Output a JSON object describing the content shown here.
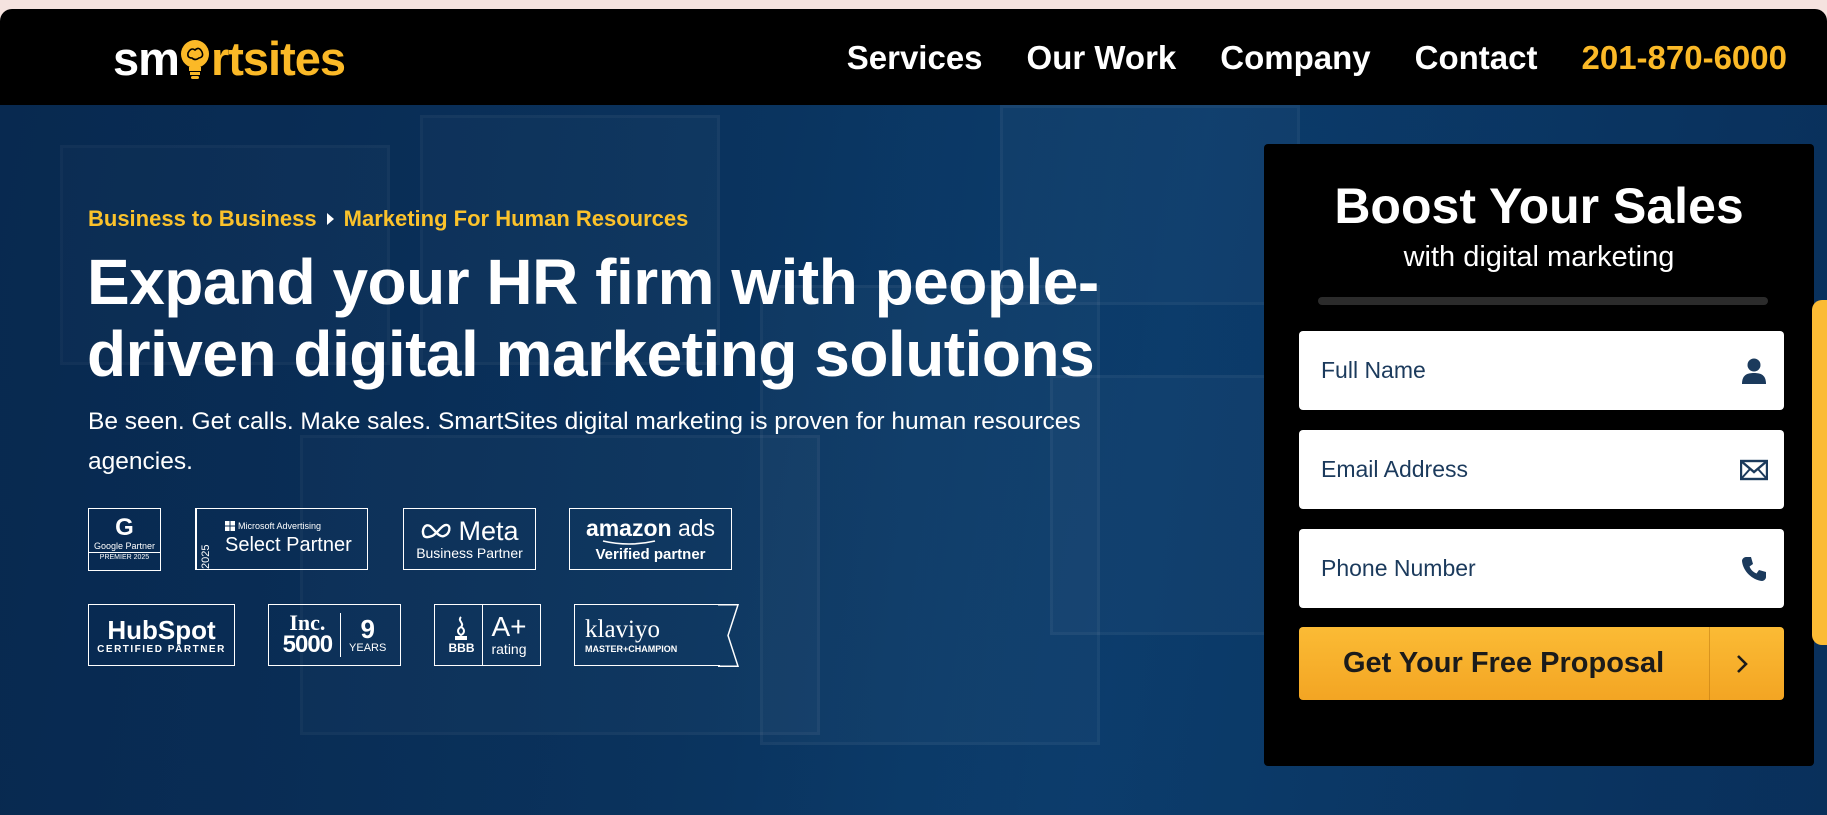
{
  "brand": {
    "logo_before": "sm",
    "logo_mid": "rt",
    "logo_after": "sites",
    "accent": "#fbb927"
  },
  "nav": {
    "items": [
      "Services",
      "Our Work",
      "Company",
      "Contact"
    ],
    "phone": "201-870-6000"
  },
  "breadcrumb": [
    "Business to Business",
    "Marketing For Human Resources"
  ],
  "hero": {
    "headline": "Expand your HR firm with people-driven digital marketing solutions",
    "subtext": "Be seen. Get calls. Make sales. SmartSites digital marketing is proven for human resources agencies."
  },
  "badges": {
    "google": {
      "letter": "G",
      "line1": "Google Partner",
      "line2": "PREMIER 2025"
    },
    "microsoft": {
      "year": "2025",
      "brand": "Microsoft Advertising",
      "label": "Select Partner"
    },
    "meta": {
      "brand": "Meta",
      "label": "Business Partner"
    },
    "amazon": {
      "brand": "amazon",
      "suffix": "ads",
      "label": "Verified partner"
    },
    "hubspot": {
      "brand": "HubSpot",
      "label": "CERTIFIED PARTNER"
    },
    "inc": {
      "line1": "Inc.",
      "line2": "5000",
      "count": "9",
      "unit": "YEARS"
    },
    "bbb": {
      "mark": "BBB",
      "grade": "A+",
      "label": "rating"
    },
    "klaviyo": {
      "brand": "klaviyo",
      "label": "MASTER+CHAMPION"
    }
  },
  "form": {
    "title": "Boost Your Sales",
    "subtitle": "with digital marketing",
    "fields": [
      {
        "placeholder": "Full Name",
        "icon": "user-icon"
      },
      {
        "placeholder": "Email Address",
        "icon": "envelope-icon"
      },
      {
        "placeholder": "Phone Number",
        "icon": "phone-icon"
      }
    ],
    "submit_label": "Get Your Free Proposal"
  }
}
